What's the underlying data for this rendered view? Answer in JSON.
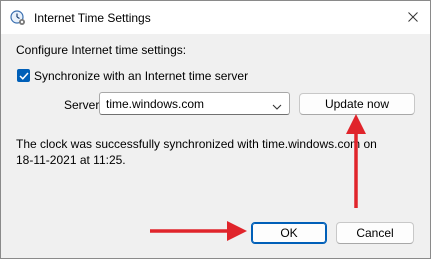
{
  "window": {
    "title": "Internet Time Settings",
    "title_icon": "clock-settings-icon",
    "close_icon": "close-icon"
  },
  "content": {
    "heading": "Configure Internet time settings:",
    "sync_checkbox": {
      "label": "Synchronize with an Internet time server",
      "checked": true
    },
    "server": {
      "label": "Server:",
      "value": "time.windows.com"
    },
    "update_button": "Update now",
    "status_line1": "The clock was successfully synchronized with time.windows.com on",
    "status_line2": "18-11-2021 at 11:25."
  },
  "footer": {
    "ok_label": "OK",
    "cancel_label": "Cancel"
  },
  "colors": {
    "accent": "#005fb8",
    "annotation_arrow": "#e0242b",
    "dialog_bg": "#f0f0f0"
  }
}
